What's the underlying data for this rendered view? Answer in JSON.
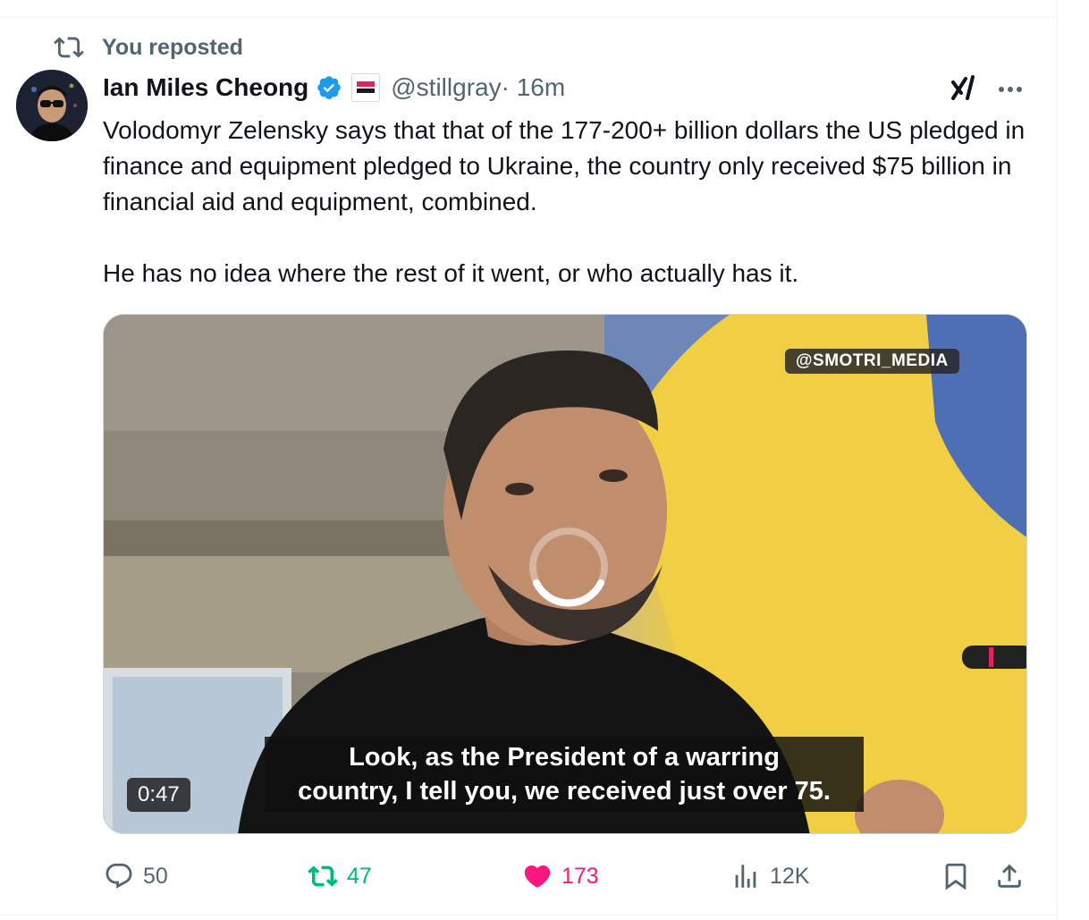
{
  "social_context": {
    "label": "You reposted",
    "icon": "repost-icon"
  },
  "author": {
    "name": "Ian Miles Cheong",
    "verified": true,
    "affiliation_badge": "ROAD ELECTION",
    "handle": "@stillgray",
    "time": " · 16m"
  },
  "tweet": {
    "text": "Volodomyr Zelensky says that that of the 177-200+ billion dollars the US pledged in finance and equipment pledged to Ukraine, the country only received $75 billion in financial aid and equipment, combined.\n\nHe has no idea where the rest of it went, or who actually has it."
  },
  "media": {
    "watermark": "@SMOTRI_MEDIA",
    "subtitle_line1": "Look, as the President of a warring",
    "subtitle_line2": "country, I tell you, we received just over 75.",
    "duration": "0:47",
    "loading": true
  },
  "actions": {
    "replies": "50",
    "reposts": "47",
    "likes": "173",
    "views": "12K",
    "reposted": true,
    "liked": true
  },
  "colors": {
    "text": "#0f1419",
    "secondary": "#536471",
    "verified": "#1d9bf0",
    "repost_active": "#00ba7c",
    "like_active": "#f91880"
  }
}
